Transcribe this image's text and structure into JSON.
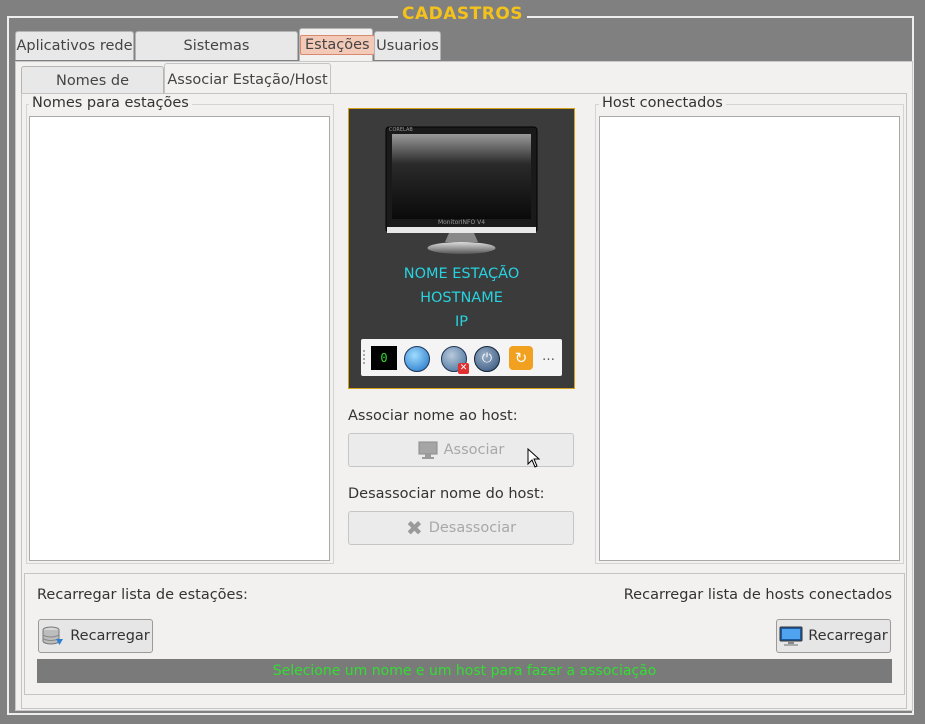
{
  "window": {
    "title": "CADASTROS"
  },
  "tabs": {
    "top": [
      "Aplicativos rede",
      "Sistemas Operacionais",
      "Estações",
      "Usuarios"
    ],
    "active_top": "Estações",
    "sub": [
      "Nomes de estações",
      "Associar Estação/Host"
    ],
    "active_sub": "Associar Estação/Host"
  },
  "left_panel": {
    "label": "Nomes para estações"
  },
  "right_panel": {
    "label": "Host conectados"
  },
  "station_card": {
    "monitor_brand": "MonitorINFO V4",
    "monitor_small": "CORELAB",
    "name": "NOME ESTAÇÃO",
    "hostname": "HOSTNAME",
    "ip": "IP",
    "counter": "0",
    "more": "…",
    "tool_icons": [
      "counter-display",
      "browser-icon",
      "browser-blocked-icon",
      "power-icon",
      "refresh-icon"
    ]
  },
  "associate": {
    "label": "Associar nome ao host:",
    "button": "Associar"
  },
  "dissociate": {
    "label": "Desassociar nome do host:",
    "button": "Desassociar"
  },
  "reload": {
    "left_label": "Recarregar lista de estações:",
    "left_button": "Recarregar",
    "right_label": "Recarregar lista de hosts conectados",
    "right_button": "Recarregar"
  },
  "status": {
    "message": "Selecione um nome e um host para fazer a associação",
    "color": "#33dd33"
  },
  "colors": {
    "title": "#f4c21a",
    "card_text": "#27d3e0",
    "card_border": "#d4a017"
  }
}
